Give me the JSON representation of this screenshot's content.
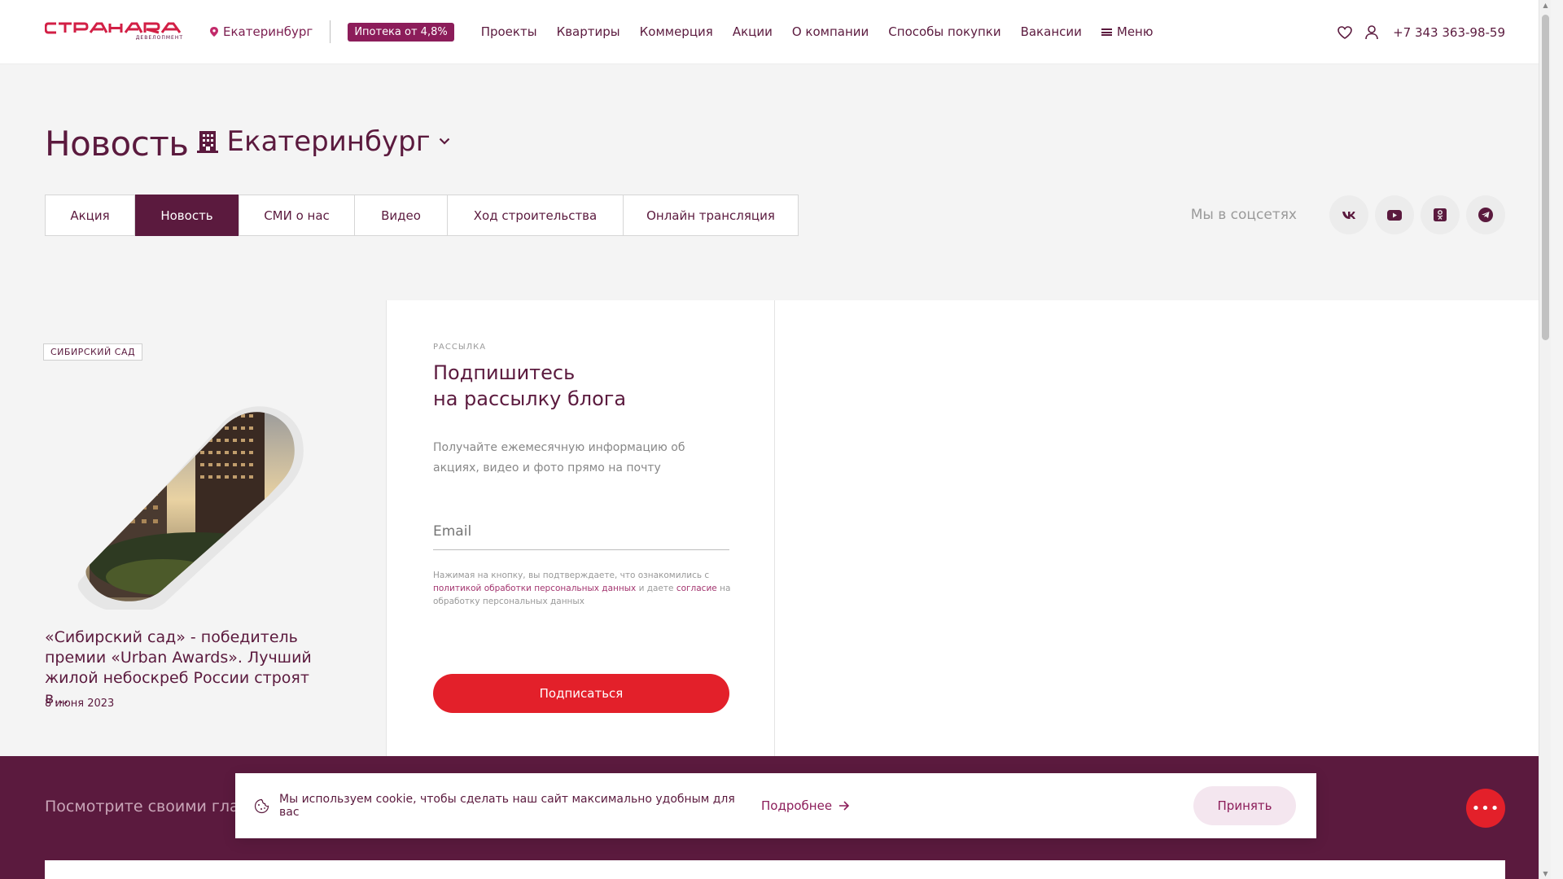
{
  "header": {
    "logo_sub": "ДЕВЕЛОПМЕНТ",
    "city": "Екатеринбург",
    "mortgage_badge": "Ипотека от 4,8%",
    "nav": [
      "Проекты",
      "Квартиры",
      "Коммерция",
      "Акции",
      "О компании",
      "Способы покупки",
      "Вакансии"
    ],
    "menu_label": "Меню",
    "phone": "+7 343 363-98-59"
  },
  "page": {
    "title": "Новость",
    "city_select": "Екатеринбург"
  },
  "tabs": [
    {
      "label": "Акция",
      "active": false
    },
    {
      "label": "Новость",
      "active": true
    },
    {
      "label": "СМИ о нас",
      "active": false
    },
    {
      "label": "Видео",
      "active": false
    },
    {
      "label": "Ход строительства",
      "active": false
    },
    {
      "label": "Онлайн трансляция",
      "active": false
    }
  ],
  "social": {
    "label": "Мы в соцсетях",
    "icons": [
      "vk-icon",
      "youtube-icon",
      "odnoklassniki-icon",
      "telegram-icon"
    ]
  },
  "news_card": {
    "tag": "СИБИРСКИЙ САД",
    "title": "«Сибирский сад» - победитель премии «Urban Awards». Лучший жилой небоскреб России строят в...",
    "date": "8 июня 2023"
  },
  "subscribe": {
    "kicker": "РАССЫЛКА",
    "title_line1": "Подпишитесь",
    "title_line2": "на рассылку блога",
    "text": "Получайте ежемесячную информацию об акциях, видео и фото прямо на почту",
    "email_placeholder": "Email",
    "legal_prefix": "Нажимая на кнопку, вы подтверждаете, что ознакомились с",
    "legal_link1": "политикой обработки персональных данных",
    "legal_mid": "и даете",
    "legal_link2": "согласие",
    "legal_suffix": "на обработку персональных данных",
    "button": "Подписаться"
  },
  "dark_band": {
    "text": "Посмотрите своими глаз"
  },
  "cookie": {
    "text": "Мы используем cookie, чтобы сделать наш сайт максимально удобным для вас",
    "more": "Подробнее",
    "accept": "Принять"
  },
  "colors": {
    "brand": "#5b1a3e",
    "accent_red": "#e3202a",
    "badge": "#8c1d5a"
  }
}
